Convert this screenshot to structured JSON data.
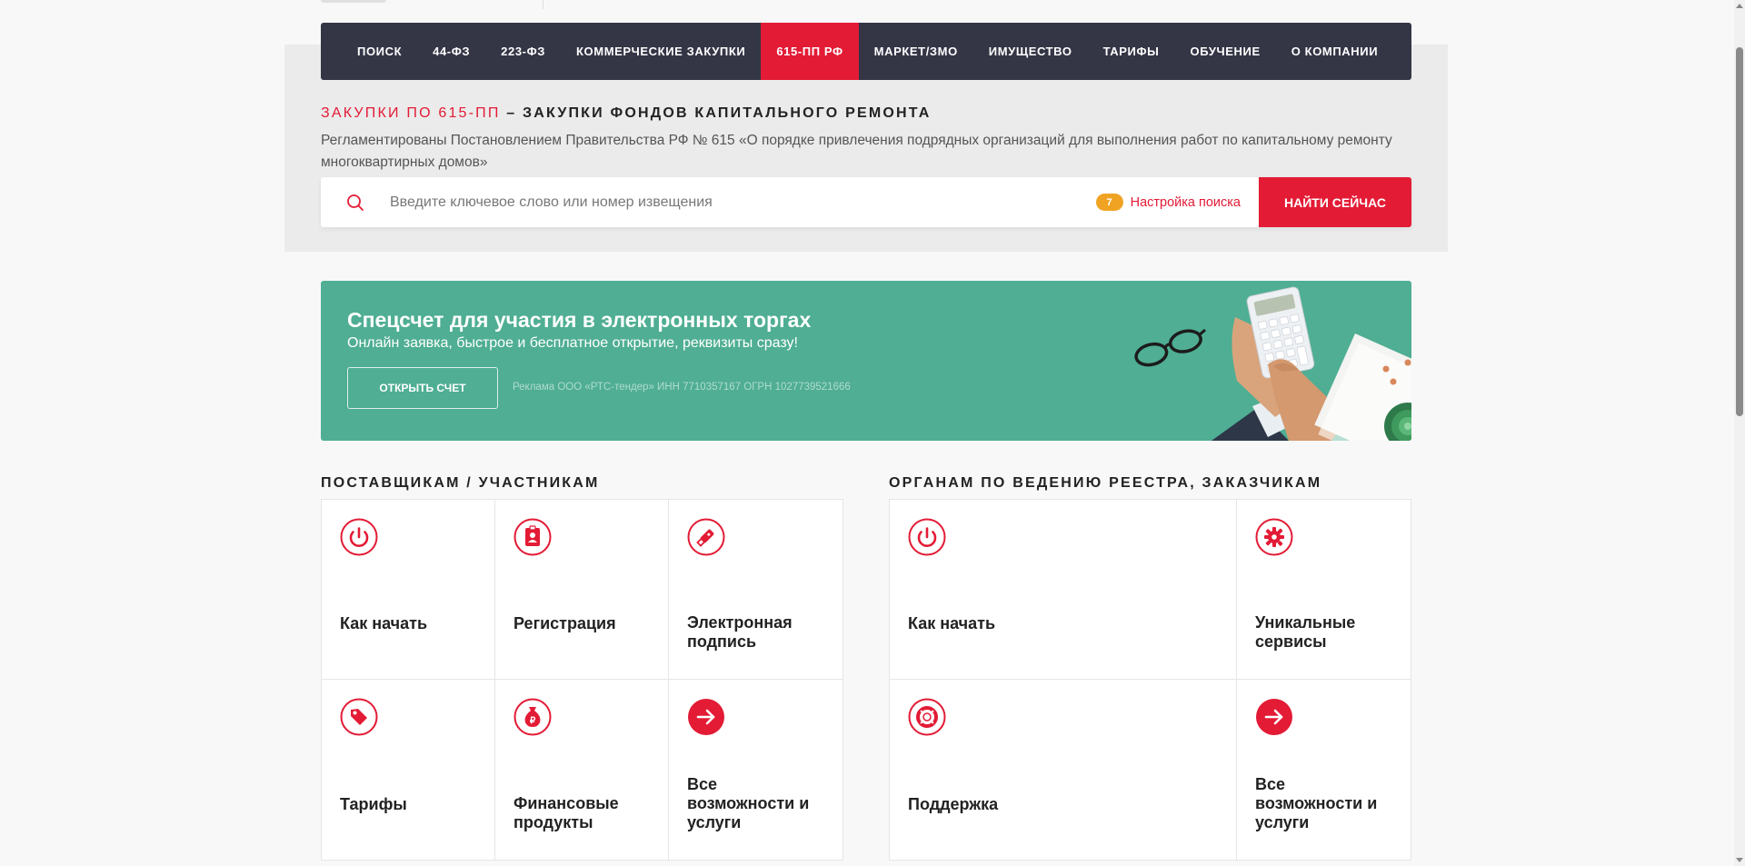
{
  "nav": {
    "items": [
      {
        "label": "ПОИСК",
        "active": false
      },
      {
        "label": "44-ФЗ",
        "active": false
      },
      {
        "label": "223-ФЗ",
        "active": false
      },
      {
        "label": "КОММЕРЧЕСКИЕ ЗАКУПКИ",
        "active": false
      },
      {
        "label": "615-ПП РФ",
        "active": true
      },
      {
        "label": "МАРКЕТ/ЗМО",
        "active": false
      },
      {
        "label": "ИМУЩЕСТВО",
        "active": false
      },
      {
        "label": "ТАРИФЫ",
        "active": false
      },
      {
        "label": "ОБУЧЕНИЕ",
        "active": false
      },
      {
        "label": "О КОМПАНИИ",
        "active": false
      }
    ]
  },
  "heading": {
    "accent": "ЗАКУПКИ ПО 615-ПП",
    "rest": " – ЗАКУПКИ ФОНДОВ КАПИТАЛЬНОГО РЕМОНТА",
    "description": "Регламентированы Постановлением Правительства РФ № 615 «О порядке привлечения подрядных организаций для выполнения работ по капитальному ремонту многоквартирных домов»"
  },
  "search": {
    "placeholder": "Введите ключевое слово или номер извещения",
    "settings_count": "7",
    "settings_label": "Настройка поиска",
    "button_label": "НАЙТИ СЕЙЧАС",
    "icon": "search-icon"
  },
  "promo": {
    "title": "Спецсчет для участия в электронных торгах",
    "subtitle": "Онлайн заявка, быстрое и бесплатное открытие, реквизиты сразу!",
    "button_label": "ОТКРЫТЬ СЧЕТ",
    "legal": "Реклама ООО «РТС-тендер» ИНН 7710357167 ОГРН 1027739521666",
    "background": "#4fae93"
  },
  "suppliers": {
    "title": "ПОСТАВЩИКАМ / УЧАСТНИКАМ",
    "cards": [
      {
        "label": "Как начать",
        "icon": "power-icon"
      },
      {
        "label": "Регистрация",
        "icon": "id-badge-icon"
      },
      {
        "label": "Электронная подпись",
        "icon": "usb-key-icon"
      },
      {
        "label": "Тарифы",
        "icon": "tag-icon"
      },
      {
        "label": "Финансовые продукты",
        "icon": "money-bag-icon"
      },
      {
        "label": "Все возможности и услуги",
        "icon": "arrow-right-icon"
      }
    ]
  },
  "customers": {
    "title": "ОРГАНАМ ПО ВЕДЕНИЮ РЕЕСТРА, ЗАКАЗЧИКАМ",
    "cards": [
      {
        "label": "Как начать",
        "icon": "power-icon"
      },
      {
        "label": "Уникальные сервисы",
        "icon": "gear-icon"
      },
      {
        "label": "Поддержка",
        "icon": "lifebuoy-icon"
      },
      {
        "label": "Все возможности и услуги",
        "icon": "arrow-right-icon"
      }
    ]
  },
  "colors": {
    "accent": "#e31b35",
    "nav_bg": "#343646",
    "badge": "#f0a323"
  }
}
